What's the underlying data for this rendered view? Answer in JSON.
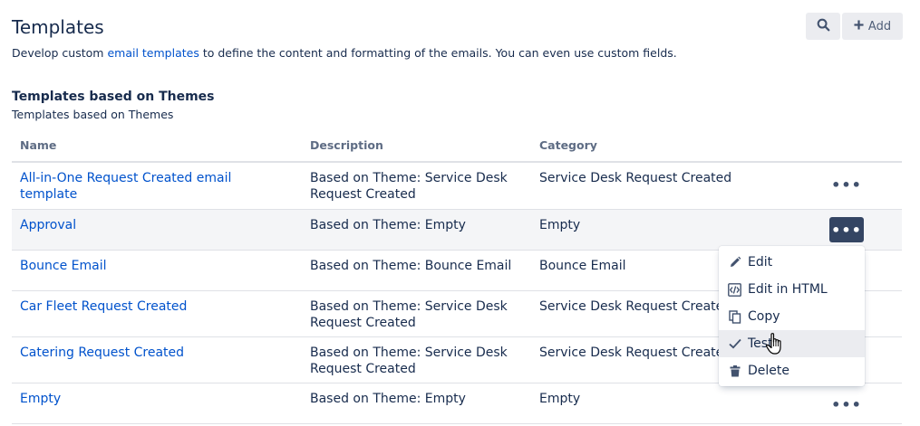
{
  "page": {
    "title": "Templates",
    "intro_before": "Develop custom ",
    "intro_link": "email templates",
    "intro_after": " to define the content and formatting of the emails. You can even use custom fields."
  },
  "toolbar": {
    "search_icon": "search-icon",
    "add_icon": "plus-icon",
    "add_label": "Add"
  },
  "section": {
    "title": "Templates based on Themes",
    "subtitle": "Templates based on Themes"
  },
  "table": {
    "columns": [
      "Name",
      "Description",
      "Category"
    ],
    "more_label": "•••",
    "rows": [
      {
        "name": "All-in-One Request Created email template",
        "description": "Based on Theme: Service Desk Request Created",
        "category": "Service Desk Request Created"
      },
      {
        "name": "Approval",
        "description": "Based on Theme: Empty",
        "category": "Empty"
      },
      {
        "name": "Bounce Email",
        "description": "Based on Theme: Bounce Email",
        "category": "Bounce Email"
      },
      {
        "name": "Car Fleet Request Created",
        "description": "Based on Theme: Service Desk Request Created",
        "category": "Service Desk Request Created"
      },
      {
        "name": "Catering Request Created",
        "description": "Based on Theme: Service Desk Request Created",
        "category": "Service Desk Request Created"
      },
      {
        "name": "Empty",
        "description": "Based on Theme: Empty",
        "category": "Empty"
      }
    ]
  },
  "menu": {
    "items": [
      {
        "label": "Edit",
        "icon": "pencil-icon"
      },
      {
        "label": "Edit in HTML",
        "icon": "code-icon"
      },
      {
        "label": "Copy",
        "icon": "copy-icon"
      },
      {
        "label": "Test",
        "icon": "check-icon"
      },
      {
        "label": "Delete",
        "icon": "trash-icon"
      }
    ]
  },
  "colors": {
    "link": "#0052cc",
    "text": "#172b4d",
    "active_button": "#344563",
    "row_highlight": "#f4f5f7"
  }
}
